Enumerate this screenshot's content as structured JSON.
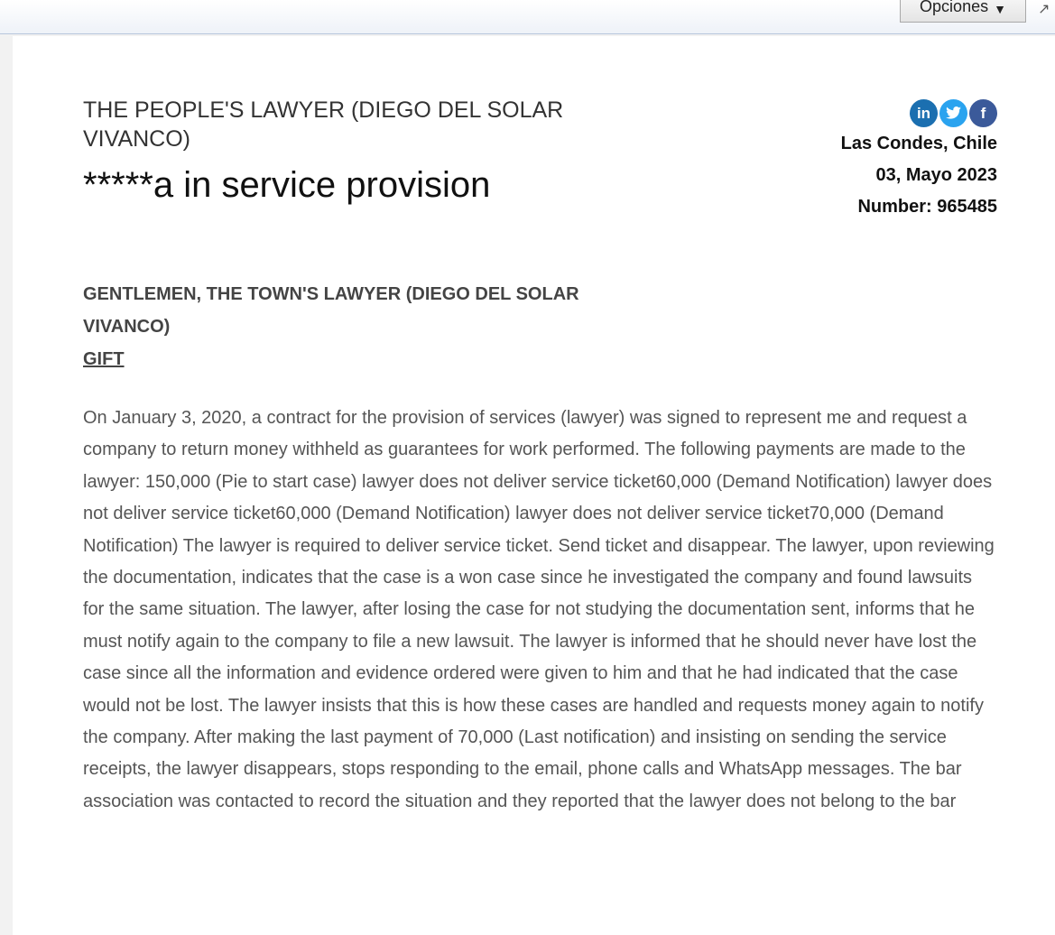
{
  "toolbar": {
    "options_label": "Opciones",
    "options_arrow": "▼",
    "expand_icon": "expand-icon"
  },
  "header": {
    "complainant": "THE PEOPLE'S LAWYER (DIEGO DEL SOLAR VIVANCO)",
    "title": "*****a in service provision"
  },
  "meta": {
    "location": "Las Condes, Chile",
    "date": "03, Mayo 2023",
    "number": "Number: 965485"
  },
  "social": {
    "linkedin": "in",
    "twitter": "t",
    "facebook": "f",
    "colors": {
      "linkedin": "#1b6fb0",
      "twitter": "#2aa3ef",
      "facebook": "#3b5a9a"
    }
  },
  "recipient": {
    "line": "GENTLEMEN, THE TOWN'S LAWYER (DIEGO DEL SOLAR VIVANCO)",
    "link": "GIFT"
  },
  "body": "On January 3, 2020, a contract for the provision of services (lawyer) was signed to represent me and request a company to return money withheld as guarantees for work performed. The following payments are made to the lawyer: 150,000 (Pie to start case) lawyer does not deliver service ticket60,000 (Demand Notification) lawyer does not deliver service ticket60,000 (Demand Notification) lawyer does not deliver service ticket70,000 (Demand Notification) The lawyer is required to deliver service ticket. Send ticket and disappear. The lawyer, upon reviewing the documentation, indicates that the case is a won case since he investigated the company and found lawsuits for the same situation. The lawyer, after losing the case for not studying the documentation sent, informs that he must notify again to the company to file a new lawsuit. The lawyer is informed that he should never have lost the case since all the information and evidence ordered were given to him and that he had indicated that the case would not be lost. The lawyer insists that this is how these cases are handled and requests money again to notify the company. After making the last payment of 70,000 (Last notification) and insisting on sending the service receipts, the lawyer disappears, stops responding to the email, phone calls and WhatsApp messages. The bar association was contacted to record the situation and they reported that the lawyer does not belong to the bar"
}
